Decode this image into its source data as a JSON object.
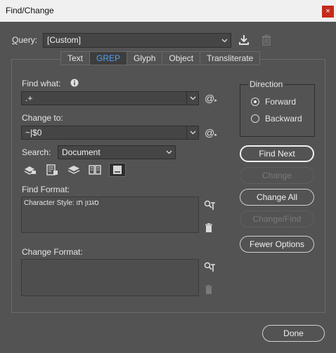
{
  "window": {
    "title": "Find/Change",
    "close_glyph": "×"
  },
  "query": {
    "label": "Query:",
    "value": "[Custom]"
  },
  "tabs": [
    {
      "label": "Text",
      "active": false
    },
    {
      "label": "GREP",
      "active": true
    },
    {
      "label": "Glyph",
      "active": false
    },
    {
      "label": "Object",
      "active": false
    },
    {
      "label": "Transliterate",
      "active": false
    }
  ],
  "find_what": {
    "label": "Find what:",
    "value": ".+"
  },
  "change_to": {
    "label": "Change to:",
    "value": "~|$0"
  },
  "search": {
    "label": "Search:",
    "value": "Document"
  },
  "find_format": {
    "label": "Find Format:",
    "value": "Character Style: סגנון תו"
  },
  "change_format": {
    "label": "Change Format:",
    "value": ""
  },
  "direction": {
    "label": "Direction",
    "options": [
      {
        "label": "Forward",
        "selected": true
      },
      {
        "label": "Backward",
        "selected": false
      }
    ]
  },
  "buttons": {
    "find_next": "Find Next",
    "change": "Change",
    "change_all": "Change All",
    "change_find": "Change/Find",
    "fewer_options": "Fewer Options",
    "done": "Done"
  },
  "colors": {
    "background": "#535353",
    "active_tab_text": "#4da3ff",
    "close_button": "#c42b1c"
  }
}
